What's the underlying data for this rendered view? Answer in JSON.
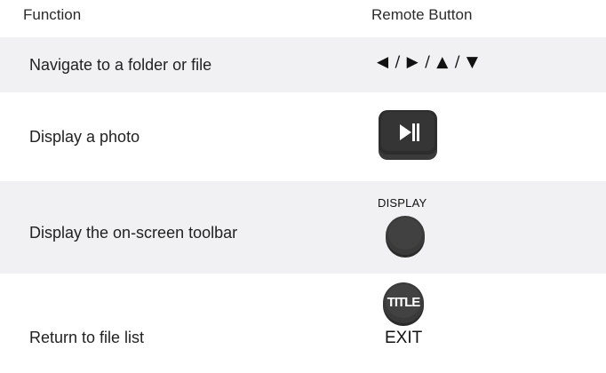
{
  "header": {
    "function": "Function",
    "remote_button": "Remote Button"
  },
  "rows": [
    {
      "function": "Navigate to a folder or file",
      "button_text": "◀ / ▶ / ▲ / ▼",
      "shaded": true
    },
    {
      "function": "Display a photo",
      "button_icon": "play-pause-icon",
      "shaded": false
    },
    {
      "function": "Display the on-screen toolbar",
      "button_label": "DISPLAY",
      "button_icon": "round-display-button",
      "shaded": true
    },
    {
      "function": "Return to file list",
      "button_icon_text": "TITLE",
      "button_label": "EXIT",
      "shaded": false
    }
  ]
}
